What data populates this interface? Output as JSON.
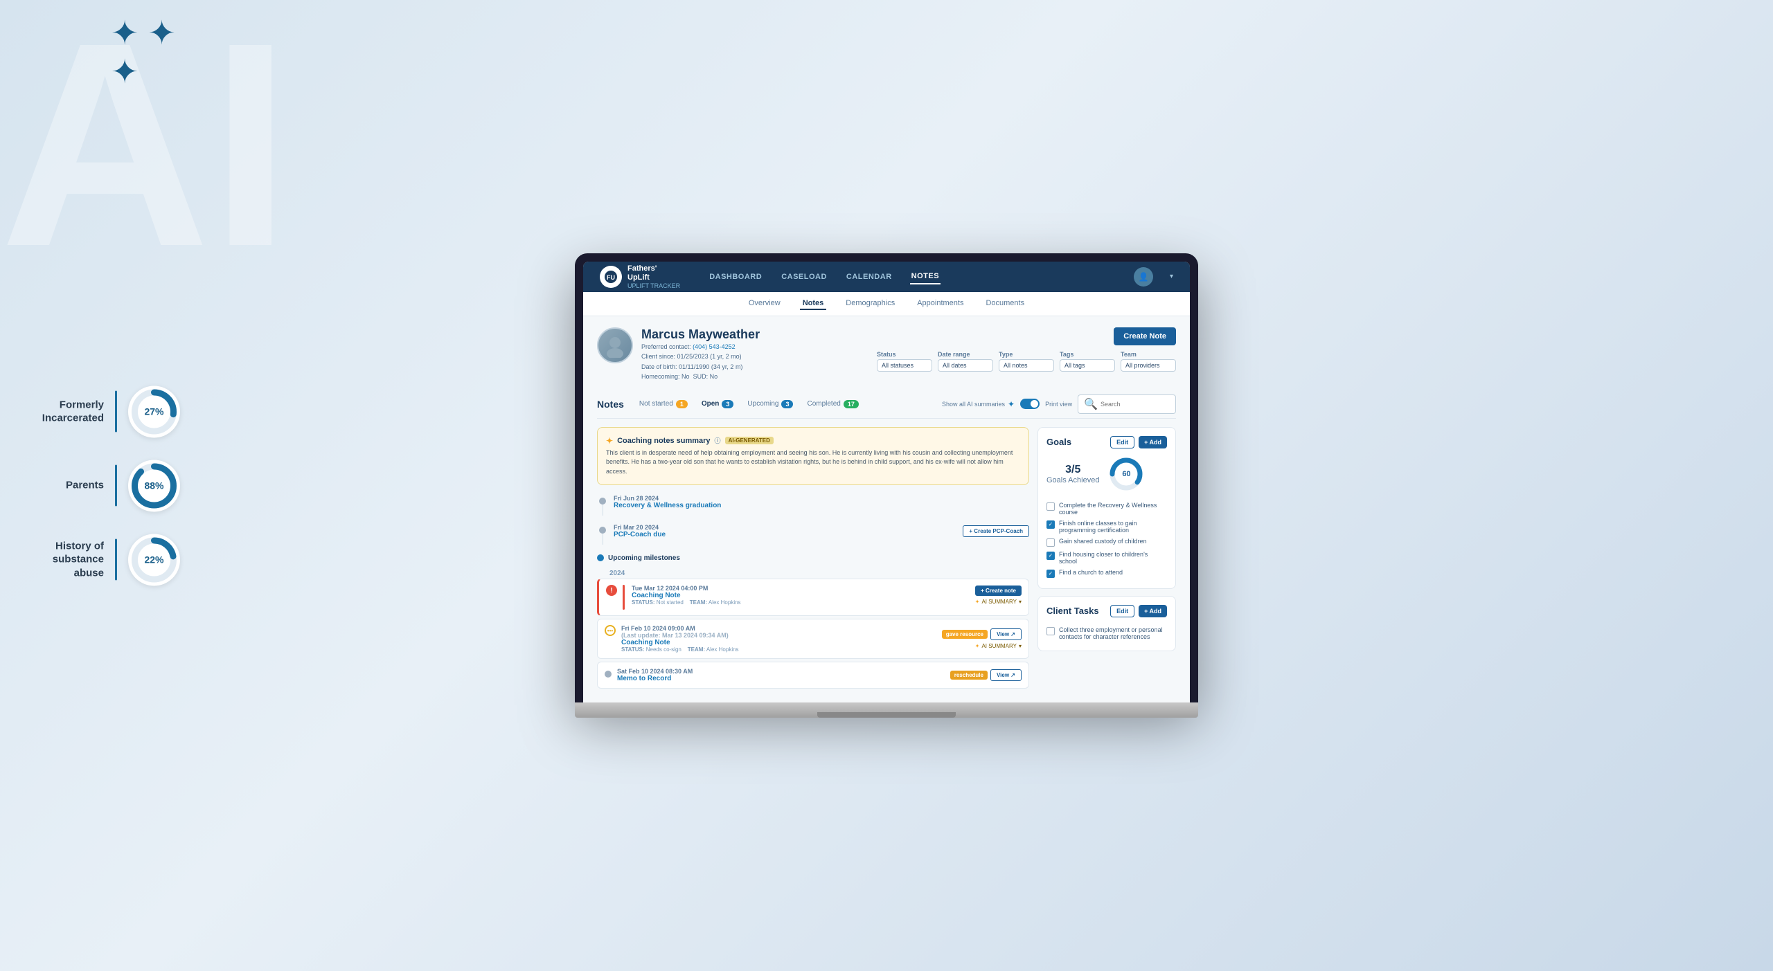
{
  "background": {
    "ai_text": "AI",
    "stars": "✦ ✦ ✦"
  },
  "stats": [
    {
      "label": "Formerly Incarcerated",
      "value": "27%",
      "percent": 27,
      "color": "#1a6fa0"
    },
    {
      "label": "Parents",
      "value": "88%",
      "percent": 88,
      "color": "#1a6fa0"
    },
    {
      "label": "History of substance abuse",
      "value": "22%",
      "percent": 22,
      "color": "#1a6fa0"
    }
  ],
  "nav": {
    "logo_line1": "Fathers'",
    "logo_line2": "UpLift",
    "logo_sub": "UPLIFT TRACKER",
    "items": [
      {
        "label": "DASHBOARD",
        "active": false
      },
      {
        "label": "CASELOAD",
        "active": false
      },
      {
        "label": "CALENDAR",
        "active": false
      },
      {
        "label": "NOTES",
        "active": true
      }
    ]
  },
  "sub_nav": {
    "items": [
      {
        "label": "Overview",
        "active": false
      },
      {
        "label": "Notes",
        "active": true
      },
      {
        "label": "Demographics",
        "active": false
      },
      {
        "label": "Appointments",
        "active": false
      },
      {
        "label": "Documents",
        "active": false
      }
    ]
  },
  "client": {
    "name": "Marcus Mayweather",
    "phone": "(404) 543-4252",
    "client_since": "01/25/2023 (1 yr, 2 mo)",
    "dob": "01/11/1990 (34 yr, 2 m)",
    "homecoming": "No",
    "sud": "No",
    "preferred_contact_label": "Preferred contact:",
    "client_since_label": "Client since:",
    "dob_label": "Date of birth:",
    "homecoming_label": "Homecoming:",
    "sud_label": "SUD:"
  },
  "create_note_btn": "Create Note",
  "filters": [
    {
      "label": "Status",
      "value": "All statuses"
    },
    {
      "label": "Date range",
      "value": "All dates"
    },
    {
      "label": "Type",
      "value": "All notes"
    },
    {
      "label": "Tags",
      "value": "All tags"
    },
    {
      "label": "Team",
      "value": "All providers"
    }
  ],
  "notes_tabs": {
    "title": "Notes",
    "tabs": [
      {
        "label": "Not started",
        "count": "1",
        "badge_type": "orange"
      },
      {
        "label": "Open",
        "count": "3",
        "badge_type": "blue"
      },
      {
        "label": "Upcoming",
        "count": "3",
        "badge_type": "blue"
      },
      {
        "label": "Completed",
        "count": "17",
        "badge_type": "green"
      }
    ],
    "show_summaries": "Show all AI summaries",
    "print_view": "Print view",
    "search_placeholder": "Search"
  },
  "ai_summary": {
    "title": "Coaching notes summary",
    "badge": "AI-GENERATED",
    "text": "This client is in desperate need of help obtaining employment and seeing his son. He is currently living with his cousin and collecting unemployment benefits. He has a two-year old son that he wants to establish visitation rights, but he is behind in child support, and his ex-wife will not allow him access."
  },
  "timeline": [
    {
      "date": "Fri Jun 28 2024",
      "title": "Recovery & Wellness graduation",
      "type": "milestone",
      "dot": "gray"
    },
    {
      "date": "Fri Mar 20 2024",
      "title": "PCP-Coach due",
      "type": "milestone",
      "dot": "gray",
      "action": "+ Create PCP-Coach"
    },
    {
      "section": "Upcoming milestones",
      "year": "2024"
    },
    {
      "date": "Tue Mar 12 2024 04:00 PM",
      "title": "Coaching Note",
      "status": "Not started",
      "team": "Alex Hopkins",
      "type": "note",
      "dot": "error",
      "action_primary": "+ Create note",
      "action_ai": "AI SUMMARY"
    },
    {
      "date": "Fri Feb 10 2024 09:00 AM",
      "date_sub": "(Last update: Mar 13 2024 09:34 AM)",
      "title": "Coaching Note",
      "status": "Needs co-sign",
      "team": "Alex Hopkins",
      "type": "note",
      "dot": "ellipsis",
      "tag": "gave resource",
      "action_view": "View ↗",
      "action_ai": "AI SUMMARY"
    },
    {
      "date": "Sat Feb 10 2024 08:30 AM",
      "title": "Memo to Record",
      "type": "note",
      "dot": "gray",
      "tag": "reschedule",
      "action_view": "View ↗"
    }
  ],
  "goals": {
    "title": "Goals",
    "edit_label": "Edit",
    "add_label": "+ Add",
    "achieved": "3/5",
    "achieved_label": "Goals Achieved",
    "percent": 60,
    "items": [
      {
        "label": "Complete the Recovery & Wellness course",
        "checked": false
      },
      {
        "label": "Finish online classes to gain programming certification",
        "checked": true
      },
      {
        "label": "Gain shared custody of children",
        "checked": false
      },
      {
        "label": "Find housing closer to children's school",
        "checked": true
      },
      {
        "label": "Find a church to attend",
        "checked": true
      }
    ]
  },
  "client_tasks": {
    "title": "Client Tasks",
    "edit_label": "Edit",
    "add_label": "+ Add",
    "items": [
      {
        "label": "Collect three employment or personal contacts for character references",
        "checked": false
      }
    ]
  }
}
